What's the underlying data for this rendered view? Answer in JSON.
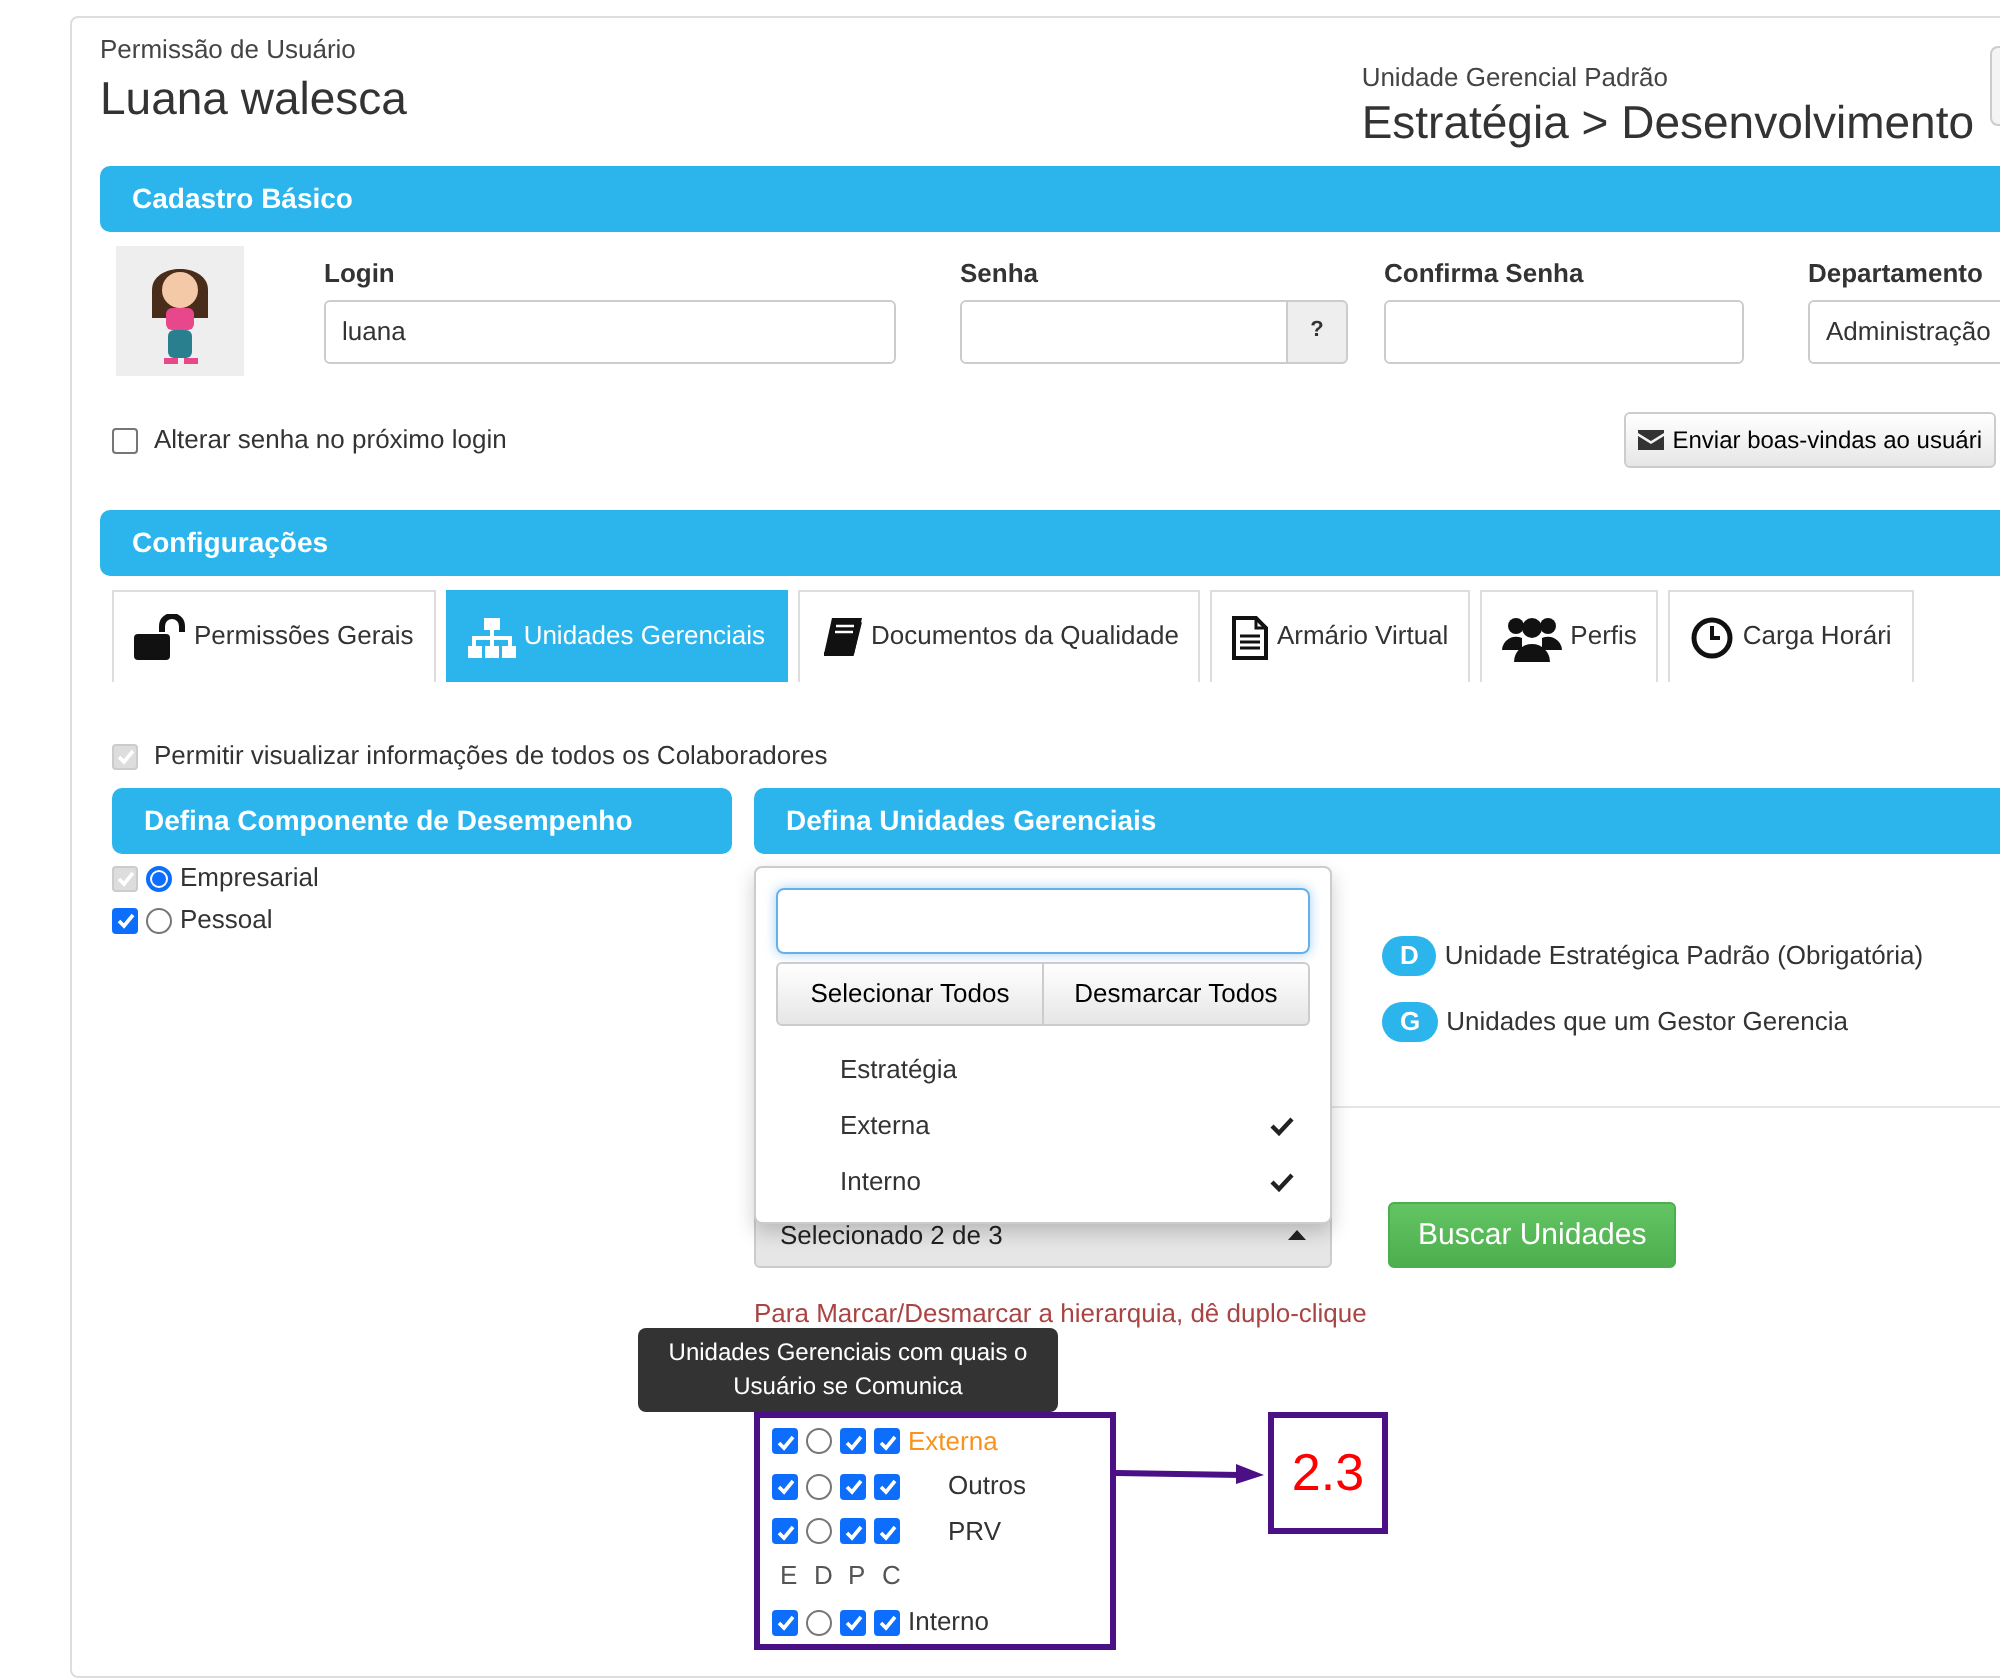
{
  "header": {
    "caption": "Permissão de Usuário",
    "user_name": "Luana walesca",
    "unit_caption": "Unidade Gerencial Padrão",
    "unit_path": "Estratégia > Desenvolvimento"
  },
  "basic": {
    "title": "Cadastro Básico",
    "fields": [
      {
        "kind": "text",
        "label": "Login",
        "value": "luana"
      },
      {
        "kind": "addon",
        "label": "Senha",
        "addon": "?"
      },
      {
        "kind": "text",
        "label": "Confirma Senha"
      },
      {
        "kind": "select",
        "label": "Departamento",
        "value": "Administração"
      }
    ],
    "change_password": {
      "label": "Alterar senha no próximo login",
      "checked": false
    },
    "welcome_button": "Enviar boas-vindas ao usuári"
  },
  "config": {
    "title": "Configurações",
    "tabs": [
      {
        "label": "Permissões Gerais",
        "selected": false
      },
      {
        "label": "Unidades Gerenciais",
        "selected": true
      },
      {
        "label": "Documentos da Qualidade",
        "selected": false
      },
      {
        "label": "Armário Virtual",
        "selected": false
      },
      {
        "label": "Perfis",
        "selected": false
      },
      {
        "label": "Carga Horári",
        "selected": false
      }
    ]
  },
  "view_all": {
    "label": "Permitir visualizar informações de todos os Colaboradores",
    "checked": true,
    "disabled": true
  },
  "performance": {
    "title": "Defina Componente de Desempenho",
    "options": [
      {
        "label": "Empresarial",
        "checked": true,
        "disabled": true,
        "selected": true
      },
      {
        "label": "Pessoal",
        "checked": true,
        "disabled": false,
        "selected": false
      }
    ]
  },
  "units": {
    "title": "Defina Unidades Gerenciais",
    "legend": [
      {
        "badge": "D",
        "text": "Unidade Estratégica Padrão (Obrigatória)"
      },
      {
        "badge": "G",
        "text": "Unidades que um Gestor Gerencia"
      }
    ],
    "dropdown": {
      "expanded": true,
      "buttons": [
        "Selecionar Todos",
        "Desmarcar Todos"
      ],
      "options": [
        {
          "label": "Estratégia",
          "checked": false
        },
        {
          "label": "Externa",
          "checked": true
        },
        {
          "label": "Interno",
          "checked": true
        }
      ]
    },
    "select_label": "Selecionado 2 de 3",
    "search_button": "Buscar Unidades",
    "hint": "Para Marcar/Desmarcar a hierarquia, dê duplo-clique",
    "tooltip": "Unidades Gerenciais com quais o Usuário se Comunica",
    "tree": [
      {
        "kind": "unit",
        "label": "Externa",
        "highlighted": true,
        "e": true,
        "d": false,
        "p": true,
        "c": true,
        "children": [
          {
            "kind": "unit",
            "label": "Outros",
            "highlighted": false,
            "e": true,
            "d": false,
            "p": true,
            "c": true
          },
          {
            "kind": "unit",
            "label": "PRV",
            "highlighted": false,
            "e": true,
            "d": false,
            "p": true,
            "c": true
          }
        ]
      },
      {
        "kind": "header",
        "columns": [
          "E",
          "D",
          "P",
          "C"
        ]
      },
      {
        "kind": "unit",
        "label": "Interno",
        "highlighted": false,
        "e": true,
        "d": false,
        "p": true,
        "c": true
      }
    ]
  },
  "annotation": {
    "label": "2.3"
  }
}
